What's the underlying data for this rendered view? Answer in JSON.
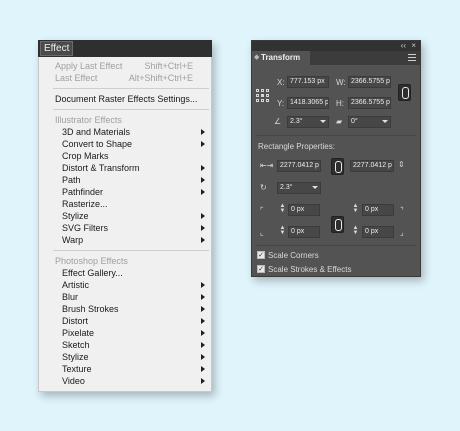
{
  "menu": {
    "title": "Effect",
    "apply_last": {
      "label": "Apply Last Effect",
      "shortcut": "Shift+Ctrl+E"
    },
    "last": {
      "label": "Last Effect",
      "shortcut": "Alt+Shift+Ctrl+E"
    },
    "doc_raster": "Document Raster Effects Settings...",
    "illustrator_header": "Illustrator Effects",
    "illustrator_items": [
      {
        "label": "3D and Materials",
        "submenu": true
      },
      {
        "label": "Convert to Shape",
        "submenu": true
      },
      {
        "label": "Crop Marks",
        "submenu": false
      },
      {
        "label": "Distort & Transform",
        "submenu": true
      },
      {
        "label": "Path",
        "submenu": true
      },
      {
        "label": "Pathfinder",
        "submenu": true
      },
      {
        "label": "Rasterize...",
        "submenu": false
      },
      {
        "label": "Stylize",
        "submenu": true
      },
      {
        "label": "SVG Filters",
        "submenu": true
      },
      {
        "label": "Warp",
        "submenu": true
      }
    ],
    "photoshop_header": "Photoshop Effects",
    "photoshop_items": [
      {
        "label": "Effect Gallery...",
        "submenu": false
      },
      {
        "label": "Artistic",
        "submenu": true
      },
      {
        "label": "Blur",
        "submenu": true
      },
      {
        "label": "Brush Strokes",
        "submenu": true
      },
      {
        "label": "Distort",
        "submenu": true
      },
      {
        "label": "Pixelate",
        "submenu": true
      },
      {
        "label": "Sketch",
        "submenu": true
      },
      {
        "label": "Stylize",
        "submenu": true
      },
      {
        "label": "Texture",
        "submenu": true
      },
      {
        "label": "Video",
        "submenu": true
      }
    ]
  },
  "panel": {
    "tab": "Transform",
    "top_controls": {
      "collapse": "‹‹",
      "close": "×"
    },
    "x": {
      "label": "X:",
      "value": "777.153 px"
    },
    "y": {
      "label": "Y:",
      "value": "1418.3065 p"
    },
    "w": {
      "label": "W:",
      "value": "2366.5755 p"
    },
    "h": {
      "label": "H:",
      "value": "2366.5755 p"
    },
    "rotate": "2.3°",
    "shear": "0°",
    "rect_header": "Rectangle Properties:",
    "rect_w": "2277.0412 p",
    "rect_h": "2277.0412 p",
    "rect_rotate": "2.3°",
    "corners": [
      "0 px",
      "0 px",
      "0 px",
      "0 px"
    ],
    "scale_corners": {
      "label": "Scale Corners",
      "checked": true
    },
    "scale_strokes": {
      "label": "Scale Strokes & Effects",
      "checked": true
    }
  }
}
